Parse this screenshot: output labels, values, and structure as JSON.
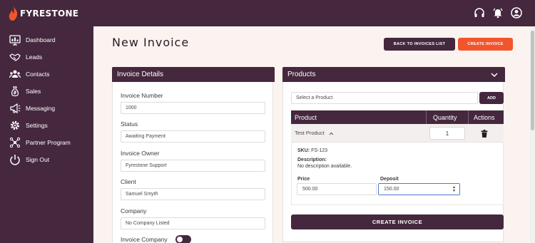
{
  "brand": {
    "name": "FYRESTONE",
    "accent": "#f2552c",
    "primary": "#45283d"
  },
  "topbar": {
    "icons": [
      "headset-icon",
      "bell-icon",
      "user-icon"
    ]
  },
  "sidebar": {
    "items": [
      {
        "label": "Dashboard",
        "icon": "dashboard-icon"
      },
      {
        "label": "Leads",
        "icon": "handshake-icon"
      },
      {
        "label": "Contacts",
        "icon": "contacts-icon"
      },
      {
        "label": "Sales",
        "icon": "money-bag-icon"
      },
      {
        "label": "Messaging",
        "icon": "megaphone-icon"
      },
      {
        "label": "Settings",
        "icon": "gear-icon"
      },
      {
        "label": "Partner Program",
        "icon": "network-icon"
      },
      {
        "label": "Sign Out",
        "icon": "power-icon"
      }
    ]
  },
  "page": {
    "title": "New Invoice",
    "back_label": "BACK TO INVOICES LIST",
    "create_label": "CREATE INVOICE"
  },
  "invoice_details": {
    "heading": "Invoice Details",
    "invoice_number_label": "Invoice Number",
    "invoice_number_value": "1000",
    "status_label": "Status",
    "status_value": "Awaiting Payment",
    "owner_label": "Invoice Owner",
    "owner_value": "Fyrestone Support",
    "client_label": "Client",
    "client_value": "Samuel Smyth",
    "company_label": "Company",
    "company_value": "No Company Listed",
    "invoice_company_label": "Invoice Company"
  },
  "products": {
    "heading": "Products",
    "select_placeholder": "Select a Product",
    "add_label": "ADD",
    "columns": [
      "Product",
      "Quantity",
      "Actions"
    ],
    "row": {
      "name": "Test Product",
      "quantity": "1",
      "sku_label": "SKU:",
      "sku_value": "FS-123",
      "description_label": "Description:",
      "description_value": "No description available.",
      "price_label": "Price",
      "price_value": "500.00",
      "deposit_label": "Deposit",
      "deposit_value": "150.00"
    },
    "create_label": "CREATE INVOICE"
  }
}
